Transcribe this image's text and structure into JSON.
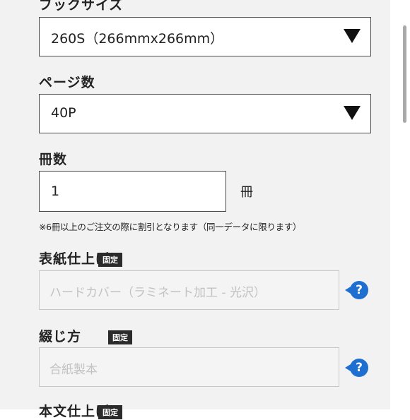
{
  "book_size": {
    "label": "ブックサイズ",
    "selected": "260S（266mmx266mm）"
  },
  "page_count": {
    "label": "ページ数",
    "selected": "40P"
  },
  "quantity": {
    "label": "冊数",
    "value": "1",
    "unit": "冊",
    "note": "※6冊以上のご注文の際に割引となります（同一データに限ります）"
  },
  "cover_finish": {
    "label": "表紙仕上げ",
    "badge": "固定",
    "value": "ハードカバー（ラミネート加工 - 光沢）"
  },
  "binding": {
    "label": "綴じ方",
    "badge": "固定",
    "value": "合紙製本"
  },
  "body_finish": {
    "label": "本文仕上げ",
    "badge": "固定"
  },
  "help_glyph": "?",
  "colors": {
    "accent": "#1e6fd0",
    "badge_bg": "#2b2b2b",
    "panel_bg": "#f2f2f2"
  }
}
